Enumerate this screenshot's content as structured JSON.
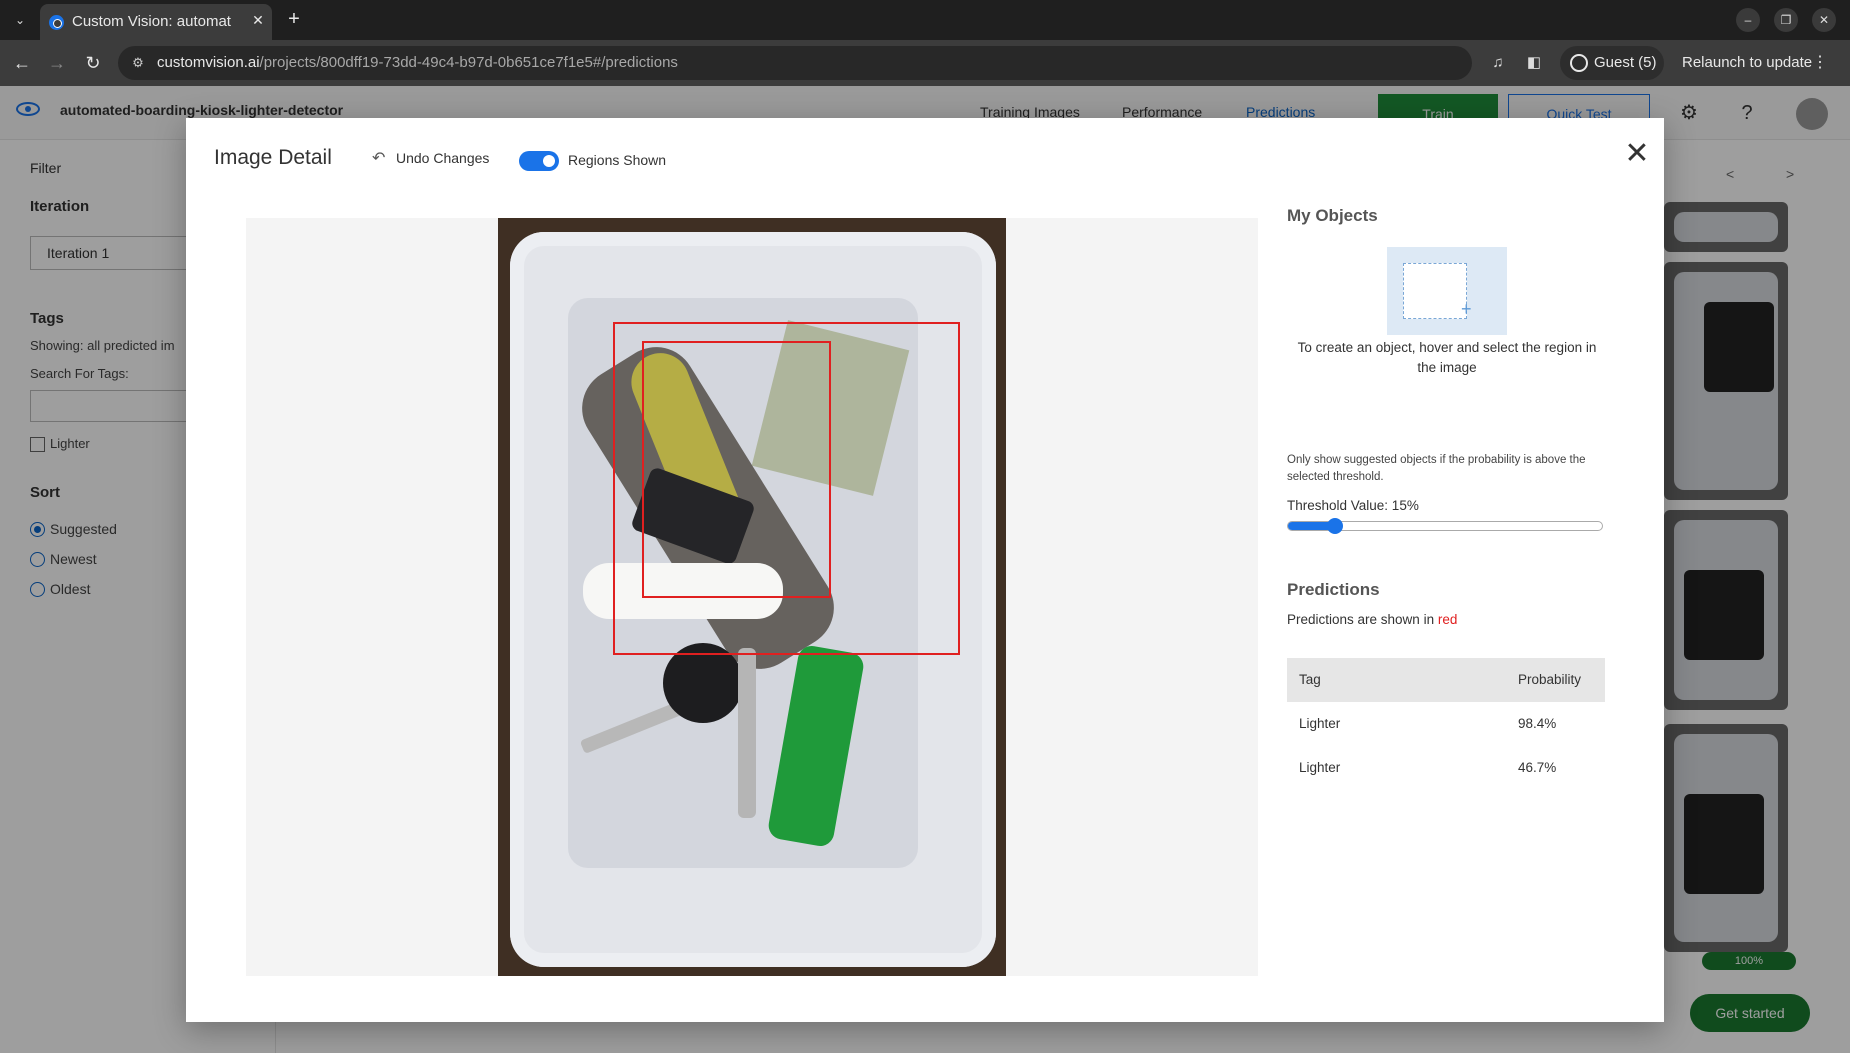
{
  "browser": {
    "tab_title": "Custom Vision: automat",
    "url_host": "customvision.ai",
    "url_path": "/projects/800dff19-73dd-49c4-b97d-0b651ce7f1e5#/predictions",
    "guest_label": "Guest (5)",
    "relaunch_label": "Relaunch to update"
  },
  "app": {
    "project_name": "automated-boarding-kiosk-lighter-detector",
    "nav": [
      "Training Images",
      "Performance",
      "Predictions"
    ],
    "train_label": "Train",
    "quick_test_label": "Quick Test",
    "sidebar": {
      "filter_label": "Filter",
      "iteration_heading": "Iteration",
      "iteration_value": "Iteration 1",
      "tags_heading": "Tags",
      "showing_text": "Showing: all predicted im",
      "search_label": "Search For Tags:",
      "tag_checkbox": "Lighter",
      "sort_heading": "Sort",
      "sort_options": [
        "Suggested",
        "Newest",
        "Oldest"
      ]
    },
    "pager_prev": "<",
    "pager_next": ">",
    "progress_label": "100%",
    "get_started_label": "Get started"
  },
  "modal": {
    "title": "Image Detail",
    "undo_label": "Undo Changes",
    "regions_label": "Regions Shown",
    "close_glyph": "✕",
    "my_objects_heading": "My Objects",
    "object_hint": "To create an object, hover and select the region in the image",
    "threshold_note": "Only show suggested objects if the probability is above the selected threshold.",
    "threshold_label": "Threshold Value: 15%",
    "threshold_value": 0.15,
    "predictions_heading": "Predictions",
    "predictions_note_prefix": "Predictions are shown in ",
    "predictions_note_color_word": "red",
    "table_headers": [
      "Tag",
      "Probability"
    ],
    "predictions": [
      {
        "tag": "Lighter",
        "probability": "98.4%"
      },
      {
        "tag": "Lighter",
        "probability": "46.7%"
      }
    ]
  },
  "colors": {
    "accent": "#1a73e8",
    "region": "#e02020",
    "train_green": "#1f8f3a"
  }
}
